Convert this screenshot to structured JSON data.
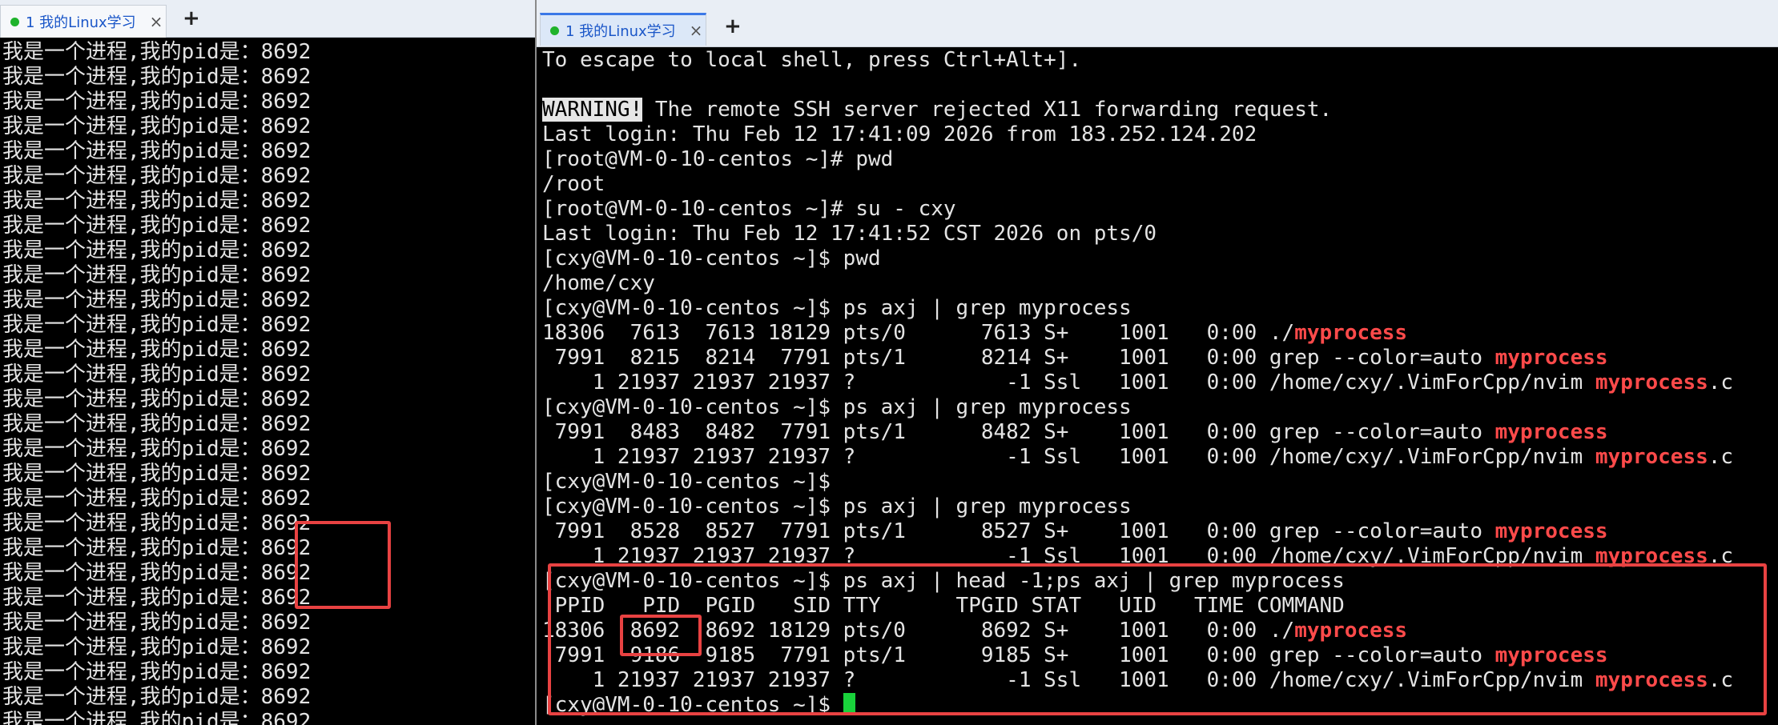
{
  "left": {
    "tab": {
      "label": "1 我的Linux学习",
      "close": "×"
    },
    "add_tab": "+",
    "lines": [
      "我是一个进程,我的pid是：8692",
      "我是一个进程,我的pid是：8692",
      "我是一个进程,我的pid是：8692",
      "我是一个进程,我的pid是：8692",
      "我是一个进程,我的pid是：8692",
      "我是一个进程,我的pid是：8692",
      "我是一个进程,我的pid是：8692",
      "我是一个进程,我的pid是：8692",
      "我是一个进程,我的pid是：8692",
      "我是一个进程,我的pid是：8692",
      "我是一个进程,我的pid是：8692",
      "我是一个进程,我的pid是：8692",
      "我是一个进程,我的pid是：8692",
      "我是一个进程,我的pid是：8692",
      "我是一个进程,我的pid是：8692",
      "我是一个进程,我的pid是：8692",
      "我是一个进程,我的pid是：8692",
      "我是一个进程,我的pid是：8692",
      "我是一个进程,我的pid是：8692",
      "我是一个进程,我的pid是：8692",
      "我是一个进程,我的pid是：8692",
      "我是一个进程,我的pid是：8692",
      "我是一个进程,我的pid是：8692",
      "我是一个进程,我的pid是：8692",
      "我是一个进程,我的pid是：8692",
      "我是一个进程,我的pid是：8692",
      "我是一个进程,我的pid是：8692",
      "我是一个进程,我的pid是：8692"
    ]
  },
  "right": {
    "tab": {
      "label": "1 我的Linux学习",
      "close": "×"
    },
    "add_tab": "+",
    "lines": [
      [
        {
          "t": "To escape to local shell, press Ctrl+Alt+]."
        }
      ],
      [
        {
          "t": ""
        }
      ],
      [
        {
          "t": "WARNING!",
          "warn": true
        },
        {
          "t": " The remote SSH server rejected X11 forwarding request."
        }
      ],
      [
        {
          "t": "Last login: Thu Feb 12 17:41:09 2026 from 183.252.124.202"
        }
      ],
      [
        {
          "t": "[root@VM-0-10-centos ~]# pwd"
        }
      ],
      [
        {
          "t": "/root"
        }
      ],
      [
        {
          "t": "[root@VM-0-10-centos ~]# su - cxy"
        }
      ],
      [
        {
          "t": "Last login: Thu Feb 12 17:41:52 CST 2026 on pts/0"
        }
      ],
      [
        {
          "t": "[cxy@VM-0-10-centos ~]$ pwd"
        }
      ],
      [
        {
          "t": "/home/cxy"
        }
      ],
      [
        {
          "t": "[cxy@VM-0-10-centos ~]$ ps axj | grep myprocess"
        }
      ],
      [
        {
          "t": "18306  7613  7613 18129 pts/0      7613 S+    1001   0:00 ./"
        },
        {
          "t": "myprocess",
          "hl": true
        }
      ],
      [
        {
          "t": " 7991  8215  8214  7791 pts/1      8214 S+    1001   0:00 grep --color=auto "
        },
        {
          "t": "myprocess",
          "hl": true
        }
      ],
      [
        {
          "t": "    1 21937 21937 21937 ?            -1 Ssl   1001   0:00 /home/cxy/.VimForCpp/nvim "
        },
        {
          "t": "myprocess",
          "hl": true
        },
        {
          "t": ".c"
        }
      ],
      [
        {
          "t": "[cxy@VM-0-10-centos ~]$ ps axj | grep myprocess"
        }
      ],
      [
        {
          "t": " 7991  8483  8482  7791 pts/1      8482 S+    1001   0:00 grep --color=auto "
        },
        {
          "t": "myprocess",
          "hl": true
        }
      ],
      [
        {
          "t": "    1 21937 21937 21937 ?            -1 Ssl   1001   0:00 /home/cxy/.VimForCpp/nvim "
        },
        {
          "t": "myprocess",
          "hl": true
        },
        {
          "t": ".c"
        }
      ],
      [
        {
          "t": "[cxy@VM-0-10-centos ~]$"
        }
      ],
      [
        {
          "t": "[cxy@VM-0-10-centos ~]$ ps axj | grep myprocess"
        }
      ],
      [
        {
          "t": " 7991  8528  8527  7791 pts/1      8527 S+    1001   0:00 grep --color=auto "
        },
        {
          "t": "myprocess",
          "hl": true
        }
      ],
      [
        {
          "t": "    1 21937 21937 21937 ?            -1 Ssl   1001   0:00 /home/cxy/.VimForCpp/nvim "
        },
        {
          "t": "myprocess",
          "hl": true
        },
        {
          "t": ".c"
        }
      ],
      [
        {
          "t": "[cxy@VM-0-10-centos ~]$ ps axj | head -1;ps axj | grep myprocess"
        }
      ],
      [
        {
          "t": " PPID   PID  PGID   SID TTY      TPGID STAT   UID   TIME COMMAND"
        }
      ],
      [
        {
          "t": "18306  8692  8692 18129 pts/0      8692 S+    1001   0:00 ./"
        },
        {
          "t": "myprocess",
          "hl": true
        }
      ],
      [
        {
          "t": " 7991  9186  9185  7791 pts/1      9185 S+    1001   0:00 grep --color=auto "
        },
        {
          "t": "myprocess",
          "hl": true
        }
      ],
      [
        {
          "t": "    1 21937 21937 21937 ?            -1 Ssl   1001   0:00 /home/cxy/.VimForCpp/nvim "
        },
        {
          "t": "myprocess",
          "hl": true
        },
        {
          "t": ".c"
        }
      ],
      [
        {
          "t": "[cxy@VM-0-10-centos ~]$ "
        },
        {
          "cursor": true
        }
      ]
    ]
  },
  "colors": {
    "highlight": "#ff4a4a",
    "annotation": "#e84242",
    "cursor": "#19d23b",
    "tab_dot": "#1fb32c",
    "tab_text": "#1a56c8"
  }
}
